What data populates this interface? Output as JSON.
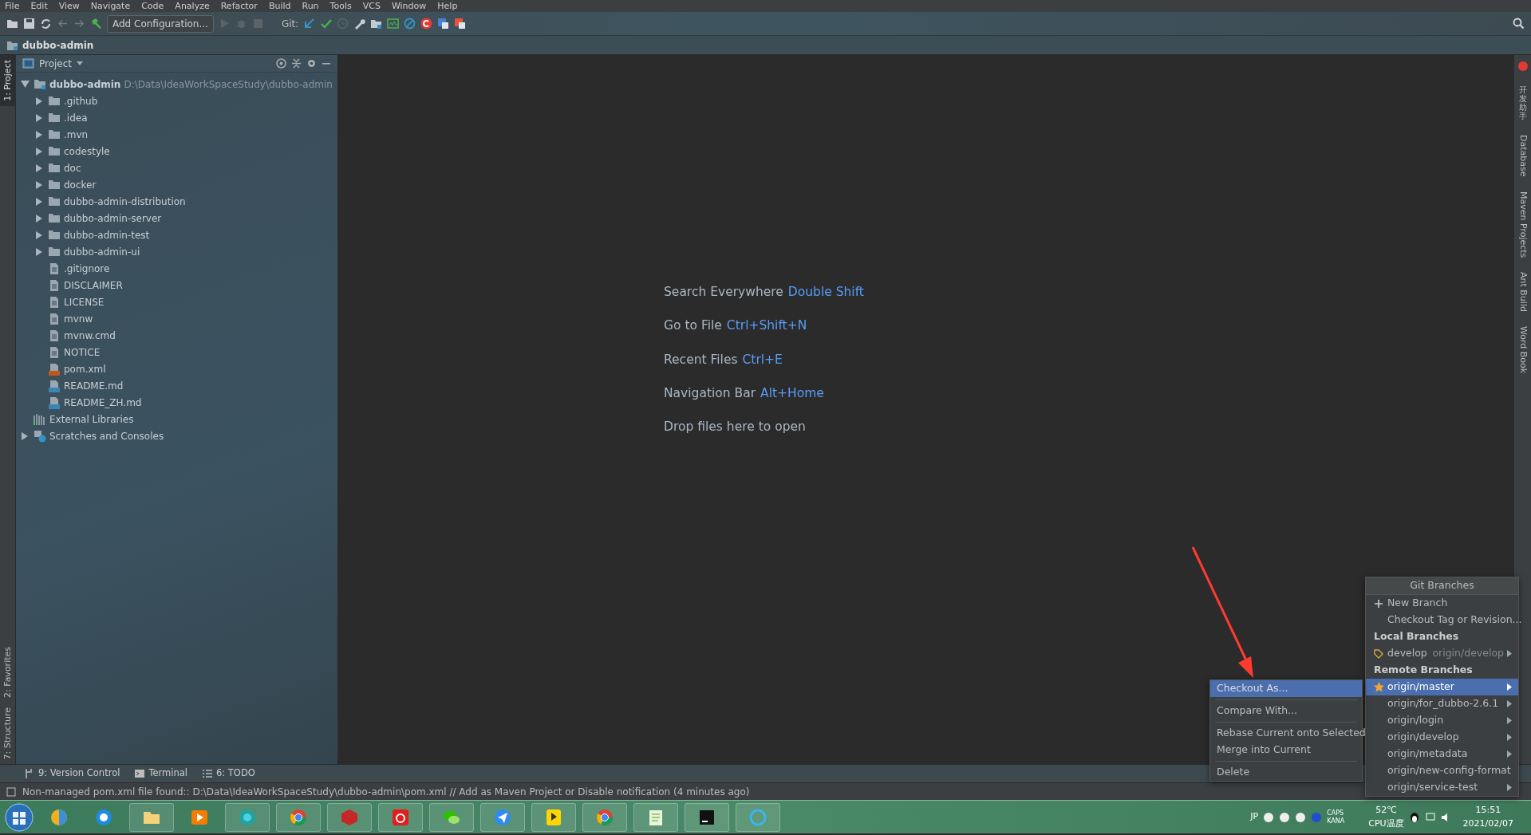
{
  "menu": [
    "File",
    "Edit",
    "View",
    "Navigate",
    "Code",
    "Analyze",
    "Refactor",
    "Build",
    "Run",
    "Tools",
    "VCS",
    "Window",
    "Help"
  ],
  "toolbar": {
    "run_config": "Add Configuration...",
    "git_label": "Git:"
  },
  "breadcrumb": "dubbo-admin",
  "left_stripe": {
    "top": [
      {
        "label": "1: Project",
        "selected": true
      }
    ],
    "bottom": [
      {
        "label": "2: Favorites",
        "selected": false
      },
      {
        "label": "7: Structure",
        "selected": false
      }
    ]
  },
  "project_panel": {
    "title": "Project",
    "tree": [
      {
        "name": "dubbo-admin",
        "path": "D:\\Data\\IdeaWorkSpaceStudy\\dubbo-admin",
        "kind": "module",
        "expanded": true,
        "children": [
          {
            "name": ".github",
            "kind": "folder",
            "expanded": false
          },
          {
            "name": ".idea",
            "kind": "folder",
            "expanded": false
          },
          {
            "name": ".mvn",
            "kind": "folder",
            "expanded": false
          },
          {
            "name": "codestyle",
            "kind": "folder",
            "expanded": false
          },
          {
            "name": "doc",
            "kind": "folder",
            "expanded": false
          },
          {
            "name": "docker",
            "kind": "folder",
            "expanded": false
          },
          {
            "name": "dubbo-admin-distribution",
            "kind": "folder",
            "expanded": false
          },
          {
            "name": "dubbo-admin-server",
            "kind": "folder",
            "expanded": false
          },
          {
            "name": "dubbo-admin-test",
            "kind": "folder",
            "expanded": false
          },
          {
            "name": "dubbo-admin-ui",
            "kind": "folder",
            "expanded": false
          },
          {
            "name": ".gitignore",
            "kind": "file"
          },
          {
            "name": "DISCLAIMER",
            "kind": "file"
          },
          {
            "name": "LICENSE",
            "kind": "file"
          },
          {
            "name": "mvnw",
            "kind": "file"
          },
          {
            "name": "mvnw.cmd",
            "kind": "file"
          },
          {
            "name": "NOTICE",
            "kind": "file"
          },
          {
            "name": "pom.xml",
            "kind": "xml"
          },
          {
            "name": "README.md",
            "kind": "md"
          },
          {
            "name": "README_ZH.md",
            "kind": "md"
          }
        ]
      },
      {
        "name": "External Libraries",
        "kind": "libraries"
      },
      {
        "name": "Scratches and Consoles",
        "kind": "scratches",
        "expanded": false
      }
    ]
  },
  "editor": {
    "hints": [
      {
        "action": "Search Everywhere",
        "shortcut": "Double Shift"
      },
      {
        "action": "Go to File",
        "shortcut": "Ctrl+Shift+N"
      },
      {
        "action": "Recent Files",
        "shortcut": "Ctrl+E"
      },
      {
        "action": "Navigation Bar",
        "shortcut": "Alt+Home"
      }
    ],
    "drop_text": "Drop files here to open"
  },
  "right_stripe": [
    {
      "label": "开发助手",
      "kind": "cjk"
    },
    {
      "label": "Database",
      "kind": "latin"
    },
    {
      "label": "Maven Projects",
      "kind": "latin"
    },
    {
      "label": "Ant Build",
      "kind": "latin"
    },
    {
      "label": "Word Book",
      "kind": "latin"
    }
  ],
  "bottom_tabs": [
    "9: Version Control",
    "Terminal",
    "6: TODO"
  ],
  "status": "Non-managed pom.xml file found:: D:\\Data\\IdeaWorkSpaceStudy\\dubbo-admin\\pom.xml // Add as Maven Project or Disable notification (4 minutes ago)",
  "git_popup": {
    "title": "Git Branches",
    "actions": [
      {
        "label": "New Branch",
        "kind": "new"
      },
      {
        "label": "Checkout Tag or Revision...",
        "kind": "plain"
      }
    ],
    "local_heading": "Local Branches",
    "local": [
      {
        "name": "develop",
        "tracking": "origin/develop",
        "current": true
      }
    ],
    "remote_heading": "Remote Branches",
    "remote": [
      {
        "name": "origin/master",
        "selected": true,
        "favorite": true
      },
      {
        "name": "origin/for_dubbo-2.6.1",
        "selected": false,
        "favorite": false
      },
      {
        "name": "origin/login",
        "selected": false,
        "favorite": false
      },
      {
        "name": "origin/develop",
        "selected": false,
        "favorite": false
      },
      {
        "name": "origin/metadata",
        "selected": false,
        "favorite": false
      },
      {
        "name": "origin/new-config-format",
        "selected": false,
        "favorite": false
      },
      {
        "name": "origin/service-test",
        "selected": false,
        "favorite": false
      }
    ]
  },
  "context_menu": {
    "groups": [
      [
        {
          "label": "Checkout As...",
          "selected": true
        }
      ],
      [
        {
          "label": "Compare With...",
          "selected": false
        }
      ],
      [
        {
          "label": "Rebase Current onto Selected",
          "selected": false
        },
        {
          "label": "Merge into Current",
          "selected": false
        }
      ],
      [
        {
          "label": "Delete",
          "selected": false
        }
      ]
    ]
  },
  "tray": {
    "ime": "JP",
    "caps": "CAPS",
    "kana": "KANA",
    "temp": "52℃",
    "temp_label": "CPU温度",
    "time": "15:51",
    "date": "2021/02/07"
  }
}
